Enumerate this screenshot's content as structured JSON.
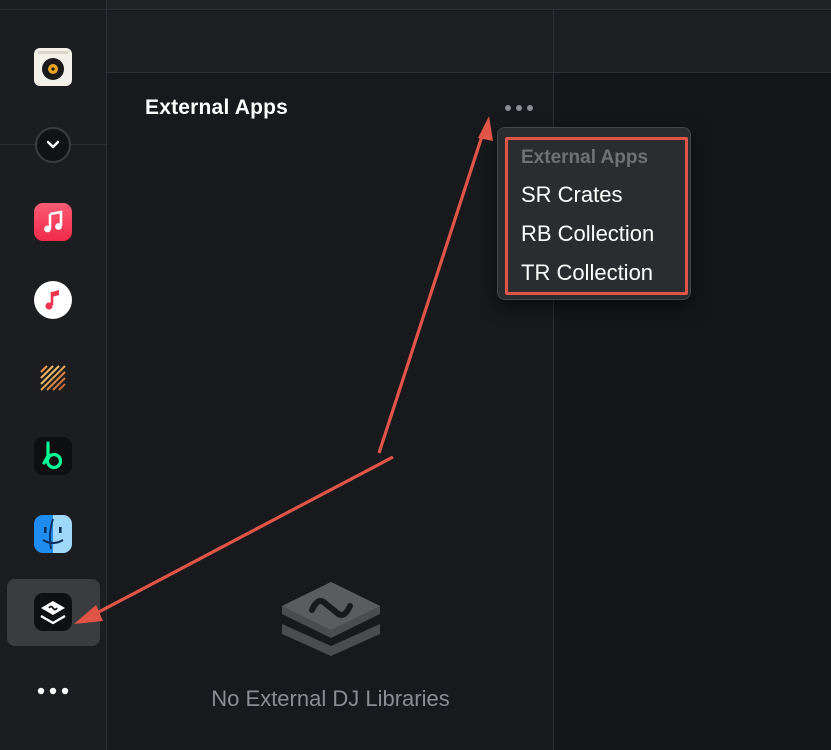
{
  "panel": {
    "title": "External Apps",
    "more_button": "more-options"
  },
  "sidebar": {
    "items": [
      {
        "name": "album-app",
        "icon": "record-player-icon"
      },
      {
        "name": "collapse",
        "icon": "chevron-down-icon"
      },
      {
        "name": "music-app",
        "icon": "music-note-icon"
      },
      {
        "name": "itunes-app",
        "icon": "music-note-icon"
      },
      {
        "name": "stripes-app",
        "icon": "diagonal-stripes-icon"
      },
      {
        "name": "beatport-app",
        "icon": "beatport-icon"
      },
      {
        "name": "finder-app",
        "icon": "finder-icon"
      },
      {
        "name": "external-apps",
        "icon": "layers-icon",
        "selected": true
      },
      {
        "name": "more",
        "icon": "ellipsis-icon"
      }
    ]
  },
  "menu": {
    "header": "External Apps",
    "items": [
      {
        "label": "SR Crates"
      },
      {
        "label": "RB Collection"
      },
      {
        "label": "TR Collection"
      }
    ]
  },
  "empty_state": {
    "text": "No External DJ Libraries"
  },
  "colors": {
    "background": "#16181b",
    "annotation": "#e05548",
    "menu_bg": "#2b2c2f"
  }
}
